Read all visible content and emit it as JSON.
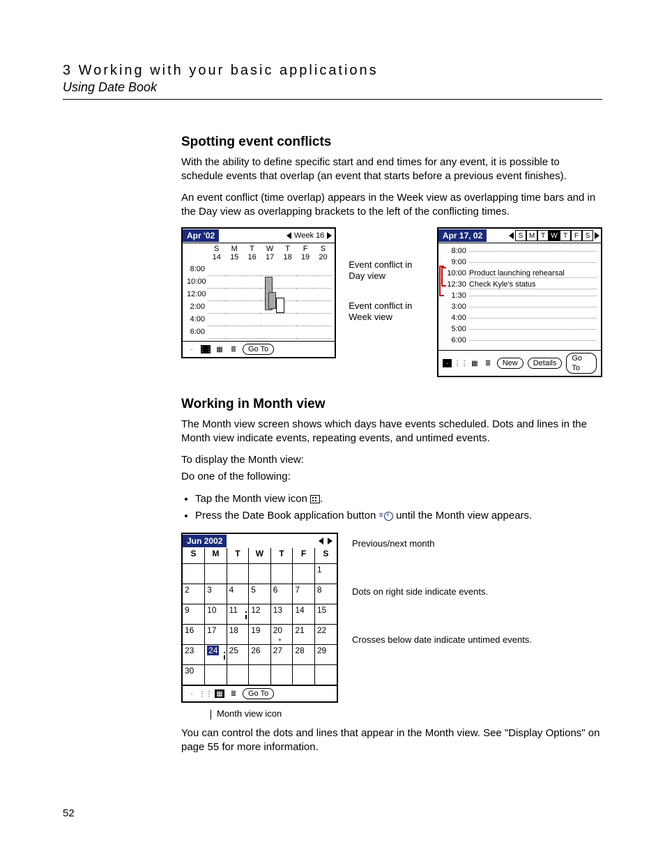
{
  "header": {
    "chapter": "3 Working with your basic applications",
    "section": "Using Date Book"
  },
  "s1": {
    "heading": "Spotting event conflicts",
    "p1": "With the ability to define specific start and end times for any event, it is possible to schedule events that overlap (an event that starts before a previous event finishes).",
    "p2": "An event conflict (time overlap) appears in the Week view as overlapping time bars and in the Day view as overlapping brackets to the left of the conflicting times."
  },
  "weekview": {
    "title": "Apr '02",
    "weeklabel": "Week 16",
    "dow": [
      "S",
      "M",
      "T",
      "W",
      "T",
      "F",
      "S"
    ],
    "dates": [
      "14",
      "15",
      "16",
      "17",
      "18",
      "19",
      "20"
    ],
    "hours": [
      "8:00",
      "10:00",
      "12:00",
      "2:00",
      "4:00",
      "6:00"
    ],
    "goto": "Go To"
  },
  "midlabels": {
    "day": "Event conflict in Day view",
    "week": "Event conflict in Week view"
  },
  "dayview": {
    "title": "Apr 17, 02",
    "dow": [
      "S",
      "M",
      "T",
      "W",
      "T",
      "F",
      "S"
    ],
    "selected_index": 3,
    "lines": [
      {
        "t": "8:00",
        "txt": ""
      },
      {
        "t": "9:00",
        "txt": ""
      },
      {
        "t": "10:00",
        "txt": "Product launching rehearsal"
      },
      {
        "t": "12:30",
        "txt": "Check Kyle's status"
      },
      {
        "t": "1:30",
        "txt": ""
      },
      {
        "t": "3:00",
        "txt": ""
      },
      {
        "t": "4:00",
        "txt": ""
      },
      {
        "t": "5:00",
        "txt": ""
      },
      {
        "t": "6:00",
        "txt": ""
      }
    ],
    "buttons": {
      "new": "New",
      "details": "Details",
      "goto": "Go To"
    }
  },
  "s2": {
    "heading": "Working in Month view",
    "p1": "The Month view screen shows which days have events scheduled. Dots and lines in the Month view indicate events, repeating events, and untimed events.",
    "lead": "To display the Month view:",
    "do": "Do one of the following:",
    "b1a": "Tap the Month view icon ",
    "b1b": ".",
    "b2a": "Press the Date Book application button ",
    "b2b": " until the Month view appears."
  },
  "monthview": {
    "title": "Jun 2002",
    "dow": [
      "S",
      "M",
      "T",
      "W",
      "T",
      "F",
      "S"
    ],
    "rows": [
      [
        "",
        "",
        "",
        "",
        "",
        "",
        "1"
      ],
      [
        "2",
        "3",
        "4",
        "5",
        "6",
        "7",
        "8"
      ],
      [
        "9",
        "10",
        "11",
        "12",
        "13",
        "14",
        "15"
      ],
      [
        "16",
        "17",
        "18",
        "19",
        "20",
        "21",
        "22"
      ],
      [
        "23",
        "24",
        "25",
        "26",
        "27",
        "28",
        "29"
      ],
      [
        "30",
        "",
        "",
        "",
        "",
        "",
        ""
      ]
    ],
    "today": "24",
    "event_dots": [
      "11",
      "24"
    ],
    "untimed": [
      "20"
    ],
    "goto": "Go To"
  },
  "rightnotes": {
    "a": "Previous/next month",
    "b": "Dots on right side indicate events.",
    "c": "Crosses below date indicate untimed events."
  },
  "caption": "Month view icon",
  "s3": {
    "p": "You can control the dots and lines that appear in the Month view. See \"Display Options\" on page 55 for more information."
  },
  "page_number": "52"
}
